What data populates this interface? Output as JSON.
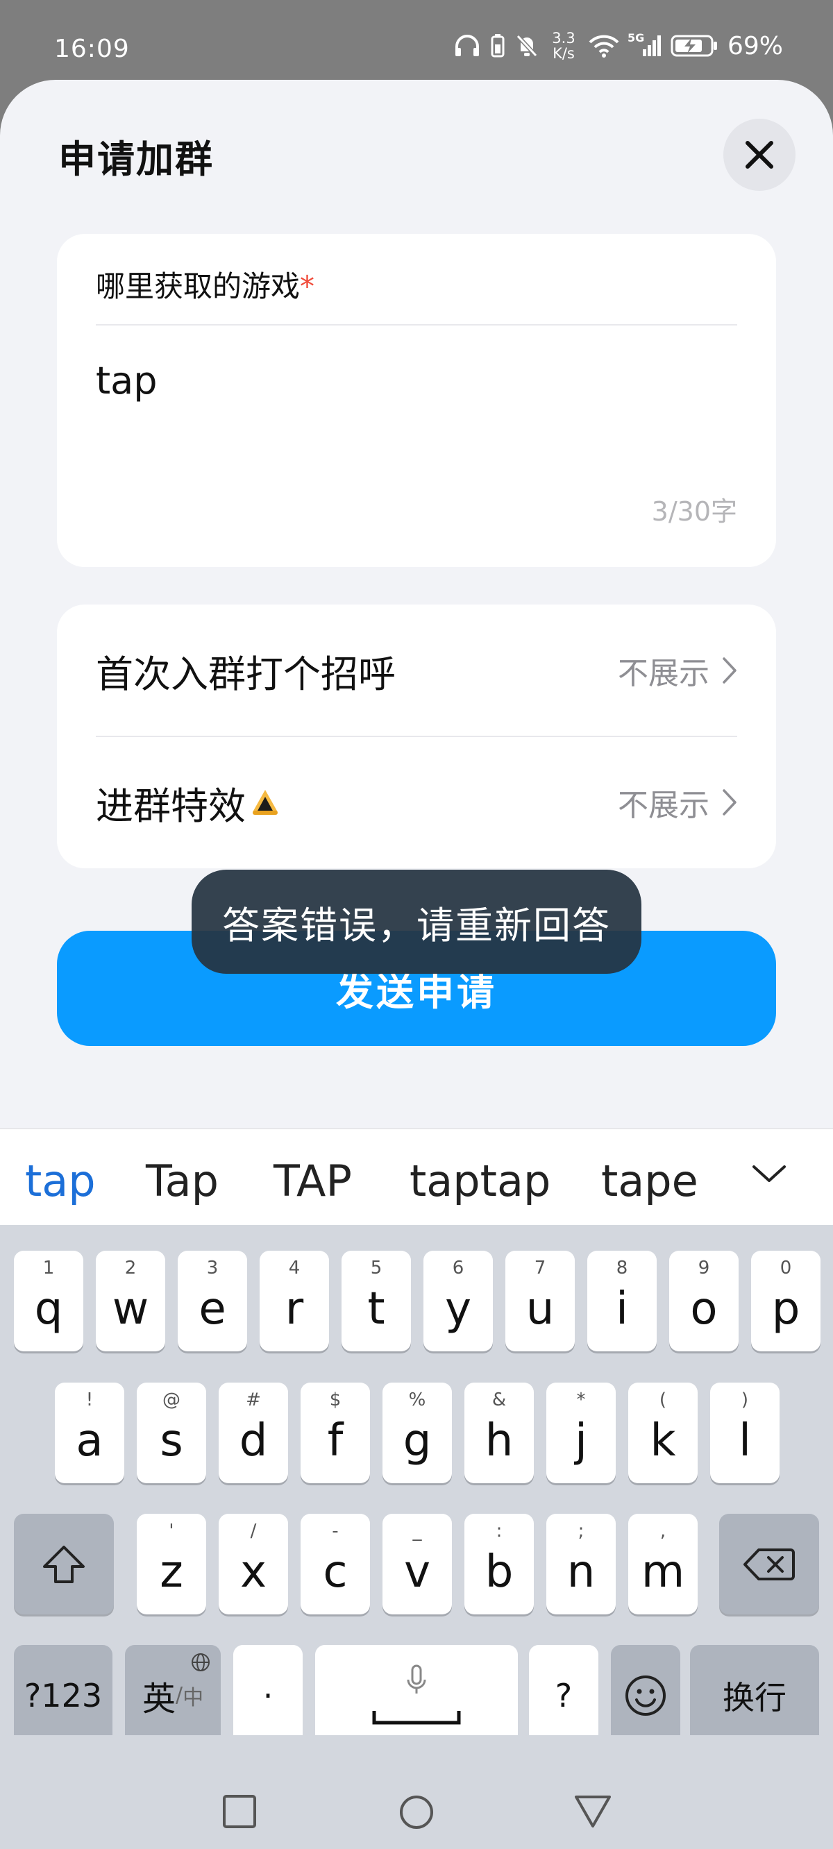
{
  "status_bar": {
    "time": "16:09",
    "speed_value": "3.3",
    "speed_unit": "K/s",
    "signal_label": "5G",
    "battery": "69%"
  },
  "sheet": {
    "title": "申请加群",
    "question": {
      "label": "哪里获取的游戏",
      "required_mark": "*",
      "answer": "tap",
      "count": "3/30字"
    },
    "rows": [
      {
        "label": "首次入群打个招呼",
        "value": "不展示"
      },
      {
        "label": "进群特效",
        "value": "不展示"
      }
    ],
    "send_button": "发送申请",
    "toast": "答案错误，请重新回答"
  },
  "suggestions": [
    "tap",
    "Tap",
    "TAP",
    "taptap",
    "tape"
  ],
  "keyboard": {
    "row1": [
      {
        "ch": "q",
        "hint": "1"
      },
      {
        "ch": "w",
        "hint": "2"
      },
      {
        "ch": "e",
        "hint": "3"
      },
      {
        "ch": "r",
        "hint": "4"
      },
      {
        "ch": "t",
        "hint": "5"
      },
      {
        "ch": "y",
        "hint": "6"
      },
      {
        "ch": "u",
        "hint": "7"
      },
      {
        "ch": "i",
        "hint": "8"
      },
      {
        "ch": "o",
        "hint": "9"
      },
      {
        "ch": "p",
        "hint": "0"
      }
    ],
    "row2": [
      {
        "ch": "a",
        "hint": "!"
      },
      {
        "ch": "s",
        "hint": "@"
      },
      {
        "ch": "d",
        "hint": "#"
      },
      {
        "ch": "f",
        "hint": "$"
      },
      {
        "ch": "g",
        "hint": "%"
      },
      {
        "ch": "h",
        "hint": "&"
      },
      {
        "ch": "j",
        "hint": "*"
      },
      {
        "ch": "k",
        "hint": "("
      },
      {
        "ch": "l",
        "hint": ")"
      }
    ],
    "row3": [
      {
        "ch": "z",
        "hint": "'"
      },
      {
        "ch": "x",
        "hint": "/"
      },
      {
        "ch": "c",
        "hint": "-"
      },
      {
        "ch": "v",
        "hint": "_"
      },
      {
        "ch": "b",
        "hint": ":"
      },
      {
        "ch": "n",
        "hint": ";"
      },
      {
        "ch": "m",
        "hint": ","
      }
    ],
    "num_key": "?123",
    "lang_key": "英",
    "lang_sub": "中",
    "dot_key": "·",
    "question_key": "?",
    "enter_key": "换行"
  },
  "colors": {
    "accent": "#0a9bff",
    "required": "#f04b3a",
    "active_suggestion": "#1c6fd8"
  }
}
